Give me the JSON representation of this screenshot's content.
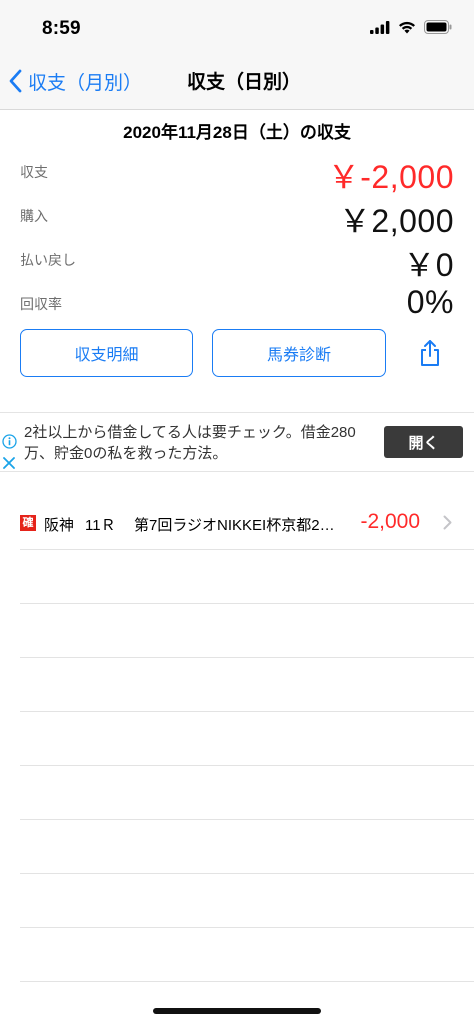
{
  "status_bar": {
    "time": "8:59"
  },
  "nav": {
    "back_label": "収支（月別）",
    "title": "収支（日別）"
  },
  "date_title": "2020年11月28日（土）の収支",
  "summary": [
    {
      "label": "収支",
      "value": "￥-2,000",
      "negative": true
    },
    {
      "label": "購入",
      "value": "￥2,000",
      "negative": false
    },
    {
      "label": "払い戻し",
      "value": "￥0",
      "negative": false
    },
    {
      "label": "回収率",
      "value": "0%",
      "negative": false
    }
  ],
  "buttons": {
    "detail_label": "収支明細",
    "diagnosis_label": "馬券診断"
  },
  "ad": {
    "text": "2社以上から借金してる人は要チェック。借金280万、貯金0の私を救った方法。",
    "open_label": "開く"
  },
  "races": [
    {
      "badge": "確",
      "venue": "阪神",
      "race_number": "11Ｒ",
      "race_name": "第7回ラジオNIKKEI杯京都2…",
      "amount": "-2,000"
    }
  ],
  "colors": {
    "accent": "#1a7cf4",
    "negative": "#ff2a2a",
    "badge": "#e5231a"
  }
}
